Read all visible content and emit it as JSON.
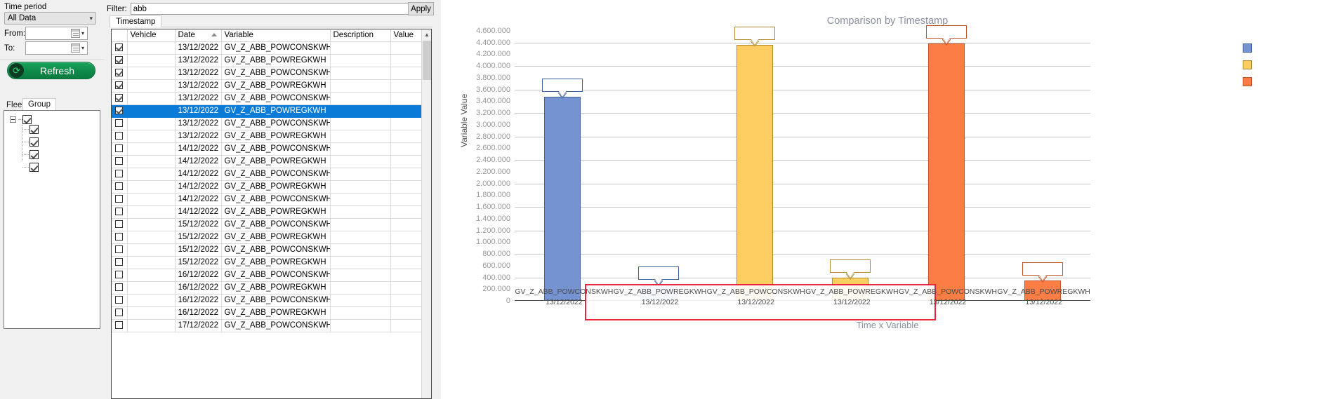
{
  "left_panel": {
    "time_period_label": "Time period",
    "period_value": "All Data",
    "period_caret": "chevron-down-icon",
    "from_label": "From:",
    "to_label": "To:",
    "from_value": "",
    "to_value": "",
    "refresh_label": "Refresh",
    "tabs": [
      {
        "label": "Fleets",
        "active": false
      },
      {
        "label": "Group",
        "active": true
      }
    ],
    "tree": {
      "root_checked": true,
      "children_checked": [
        true,
        true,
        true,
        true
      ]
    }
  },
  "grid_panel": {
    "filter_label": "Filter:",
    "filter_value": "abb",
    "filter_placeholder": "",
    "apply_label": "Apply",
    "tab_label": "Timestamp",
    "columns": [
      "",
      "Vehicle",
      "Date",
      "Variable",
      "Description",
      "Value"
    ],
    "sorted_column": "Date",
    "sort_direction": "asc",
    "rows": [
      {
        "checked": true,
        "selected": false,
        "vehicle": "",
        "date": "13/12/2022",
        "variable": "GV_Z_ABB_POWCONSKWH",
        "description": "",
        "value": ""
      },
      {
        "checked": true,
        "selected": false,
        "vehicle": "",
        "date": "13/12/2022",
        "variable": "GV_Z_ABB_POWREGKWH",
        "description": "",
        "value": ""
      },
      {
        "checked": true,
        "selected": false,
        "vehicle": "",
        "date": "13/12/2022",
        "variable": "GV_Z_ABB_POWCONSKWH",
        "description": "",
        "value": ""
      },
      {
        "checked": true,
        "selected": false,
        "vehicle": "",
        "date": "13/12/2022",
        "variable": "GV_Z_ABB_POWREGKWH",
        "description": "",
        "value": ""
      },
      {
        "checked": true,
        "selected": false,
        "vehicle": "",
        "date": "13/12/2022",
        "variable": "GV_Z_ABB_POWCONSKWH",
        "description": "",
        "value": ""
      },
      {
        "checked": true,
        "selected": true,
        "vehicle": "",
        "date": "13/12/2022",
        "variable": "GV_Z_ABB_POWREGKWH",
        "description": "",
        "value": ""
      },
      {
        "checked": false,
        "selected": false,
        "vehicle": "",
        "date": "13/12/2022",
        "variable": "GV_Z_ABB_POWCONSKWH",
        "description": "",
        "value": ""
      },
      {
        "checked": false,
        "selected": false,
        "vehicle": "",
        "date": "13/12/2022",
        "variable": "GV_Z_ABB_POWREGKWH",
        "description": "",
        "value": ""
      },
      {
        "checked": false,
        "selected": false,
        "vehicle": "",
        "date": "14/12/2022",
        "variable": "GV_Z_ABB_POWCONSKWH",
        "description": "",
        "value": ""
      },
      {
        "checked": false,
        "selected": false,
        "vehicle": "",
        "date": "14/12/2022",
        "variable": "GV_Z_ABB_POWREGKWH",
        "description": "",
        "value": ""
      },
      {
        "checked": false,
        "selected": false,
        "vehicle": "",
        "date": "14/12/2022",
        "variable": "GV_Z_ABB_POWCONSKWH",
        "description": "",
        "value": ""
      },
      {
        "checked": false,
        "selected": false,
        "vehicle": "",
        "date": "14/12/2022",
        "variable": "GV_Z_ABB_POWREGKWH",
        "description": "",
        "value": ""
      },
      {
        "checked": false,
        "selected": false,
        "vehicle": "",
        "date": "14/12/2022",
        "variable": "GV_Z_ABB_POWCONSKWH",
        "description": "",
        "value": ""
      },
      {
        "checked": false,
        "selected": false,
        "vehicle": "",
        "date": "14/12/2022",
        "variable": "GV_Z_ABB_POWREGKWH",
        "description": "",
        "value": ""
      },
      {
        "checked": false,
        "selected": false,
        "vehicle": "",
        "date": "15/12/2022",
        "variable": "GV_Z_ABB_POWCONSKWH",
        "description": "",
        "value": ""
      },
      {
        "checked": false,
        "selected": false,
        "vehicle": "",
        "date": "15/12/2022",
        "variable": "GV_Z_ABB_POWREGKWH",
        "description": "",
        "value": ""
      },
      {
        "checked": false,
        "selected": false,
        "vehicle": "",
        "date": "15/12/2022",
        "variable": "GV_Z_ABB_POWCONSKWH",
        "description": "",
        "value": ""
      },
      {
        "checked": false,
        "selected": false,
        "vehicle": "",
        "date": "15/12/2022",
        "variable": "GV_Z_ABB_POWREGKWH",
        "description": "",
        "value": ""
      },
      {
        "checked": false,
        "selected": false,
        "vehicle": "",
        "date": "16/12/2022",
        "variable": "GV_Z_ABB_POWCONSKWH",
        "description": "",
        "value": ""
      },
      {
        "checked": false,
        "selected": false,
        "vehicle": "",
        "date": "16/12/2022",
        "variable": "GV_Z_ABB_POWREGKWH",
        "description": "",
        "value": ""
      },
      {
        "checked": false,
        "selected": false,
        "vehicle": "",
        "date": "16/12/2022",
        "variable": "GV_Z_ABB_POWCONSKWH",
        "description": "",
        "value": ""
      },
      {
        "checked": false,
        "selected": false,
        "vehicle": "",
        "date": "16/12/2022",
        "variable": "GV_Z_ABB_POWREGKWH",
        "description": "",
        "value": ""
      },
      {
        "checked": false,
        "selected": false,
        "vehicle": "",
        "date": "17/12/2022",
        "variable": "GV_Z_ABB_POWCONSKWH",
        "description": "",
        "value": ""
      }
    ]
  },
  "chart_data": {
    "type": "bar",
    "title": "Comparison by Timestamp",
    "xlabel": "Time x Variable",
    "ylabel": "Variable Value",
    "ylim": [
      0,
      4600000
    ],
    "ytick_step": 200000,
    "ytick_labels": [
      "4.600.000",
      "4.400.000",
      "4.200.000",
      "4.000.000",
      "3.800.000",
      "3.600.000",
      "3.400.000",
      "3.200.000",
      "3.000.000",
      "2.800.000",
      "2.600.000",
      "2.400.000",
      "2.200.000",
      "2.000.000",
      "1.800.000",
      "1.600.000",
      "1.400.000",
      "1.200.000",
      "1.000.000",
      "800.000",
      "600.000",
      "400.000",
      "200.000",
      "0"
    ],
    "grid": true,
    "grid_every": 400000,
    "legend_position": "right",
    "categories": [
      "GV_Z_ABB_POWCONSKWH\n13/12/2022",
      "GV_Z_ABB_POWREGKWH\n13/12/2022",
      "GV_Z_ABB_POWCONSKWH\n13/12/2022",
      "GV_Z_ABB_POWREGKWH\n13/12/2022",
      "GV_Z_ABB_POWCONSKWH\n13/12/2022",
      "GV_Z_ABB_POWREGKWH\n13/12/2022"
    ],
    "bars": [
      {
        "label_var": "GV_Z_ABB_POWCONSKWH",
        "label_date": "13/12/2022",
        "value": 3480000,
        "color": "#7593d0",
        "border": "#41629c",
        "callout": ""
      },
      {
        "label_var": "GV_Z_ABB_POWREGKWH",
        "label_date": "13/12/2022",
        "value": 270000,
        "color": "#7593d0",
        "border": "#41629c",
        "callout": ""
      },
      {
        "label_var": "GV_Z_ABB_POWCONSKWH",
        "label_date": "13/12/2022",
        "value": 4360000,
        "color": "#ffce63",
        "border": "#b08a2d",
        "callout": ""
      },
      {
        "label_var": "GV_Z_ABB_POWREGKWH",
        "label_date": "13/12/2022",
        "value": 400000,
        "color": "#ffce63",
        "border": "#b08a2d",
        "callout": ""
      },
      {
        "label_var": "GV_Z_ABB_POWCONSKWH",
        "label_date": "13/12/2022",
        "value": 4380000,
        "color": "#fc7e44",
        "border": "#c35325",
        "callout": ""
      },
      {
        "label_var": "GV_Z_ABB_POWREGKWH",
        "label_date": "13/12/2022",
        "value": 345000,
        "color": "#fc7e44",
        "border": "#c35325",
        "callout": ""
      }
    ],
    "legend": [
      {
        "label": "",
        "color": "#7593d0",
        "border": "#41629c"
      },
      {
        "label": "",
        "color": "#ffce63",
        "border": "#b08a2d"
      },
      {
        "label": "",
        "color": "#fc7e44",
        "border": "#c35325"
      }
    ],
    "highlight_box_color": "#e8253a"
  }
}
